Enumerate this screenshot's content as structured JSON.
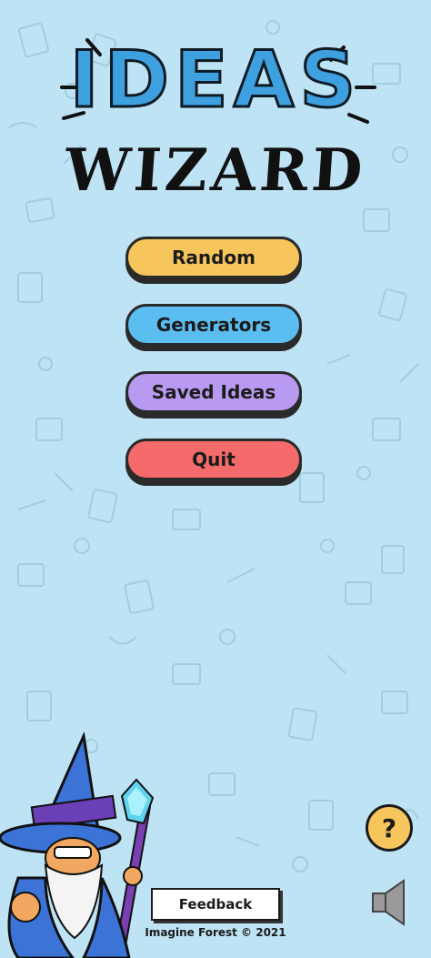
{
  "logo": {
    "line1": "IDEAS",
    "line2": "WIZARD",
    "line1_color": "#3ea0df",
    "line2_color": "#111111"
  },
  "menu": {
    "items": [
      {
        "label": "Random",
        "color": "#f6c55b"
      },
      {
        "label": "Generators",
        "color": "#5bbdf0"
      },
      {
        "label": "Saved Ideas",
        "color": "#b99af2"
      },
      {
        "label": "Quit",
        "color": "#f56a6a"
      }
    ]
  },
  "help": {
    "label": "?",
    "icon": "question-icon"
  },
  "sound": {
    "icon": "speaker-icon"
  },
  "footer": {
    "feedback_label": "Feedback",
    "copyright": "Imagine Forest © 2021"
  },
  "theme": {
    "background": "#bde3f4",
    "doodle": "#9ccbd9"
  }
}
